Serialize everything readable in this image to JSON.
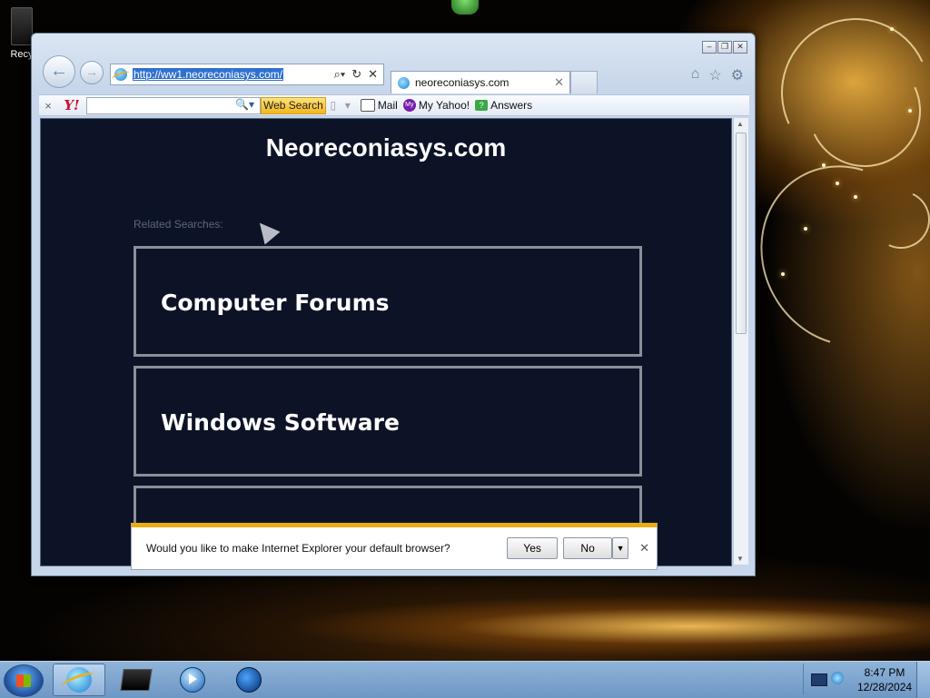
{
  "desktop": {
    "recycle_bin_label": "Recy"
  },
  "browser": {
    "address_url": "http://ww1.neoreconiasys.com/",
    "tab_title": "neoreconiasys.com",
    "window_buttons": [
      "minimize",
      "restore",
      "close"
    ],
    "right_icons": [
      "home-icon",
      "favorites-star-icon",
      "tools-gear-icon"
    ]
  },
  "toolbar": {
    "close": "×",
    "logo": "Y!",
    "search_placeholder": "",
    "web_search_label": "Web Search",
    "mail_label": "Mail",
    "my_yahoo_label": "My Yahoo!",
    "my_yahoo_icon_text": "My",
    "answers_label": "Answers"
  },
  "page": {
    "title": "Neoreconiasys.com",
    "related_label": "Related Searches:",
    "results": [
      {
        "label": "Computer Forums"
      },
      {
        "label": "Windows Software"
      },
      {
        "label": ""
      }
    ]
  },
  "notification": {
    "message": "Would you like to make Internet Explorer your default browser?",
    "yes_label": "Yes",
    "no_label": "No"
  },
  "taskbar": {
    "time": "8:47 PM",
    "date": "12/28/2024",
    "pinned": [
      "internet-explorer",
      "windows-explorer",
      "media-player",
      "globe-app"
    ]
  },
  "colors": {
    "page_background": "#0d1327",
    "notification_accent": "#e8ad10",
    "web_search_button": "#f2b51c",
    "yahoo_red": "#c8102e"
  }
}
